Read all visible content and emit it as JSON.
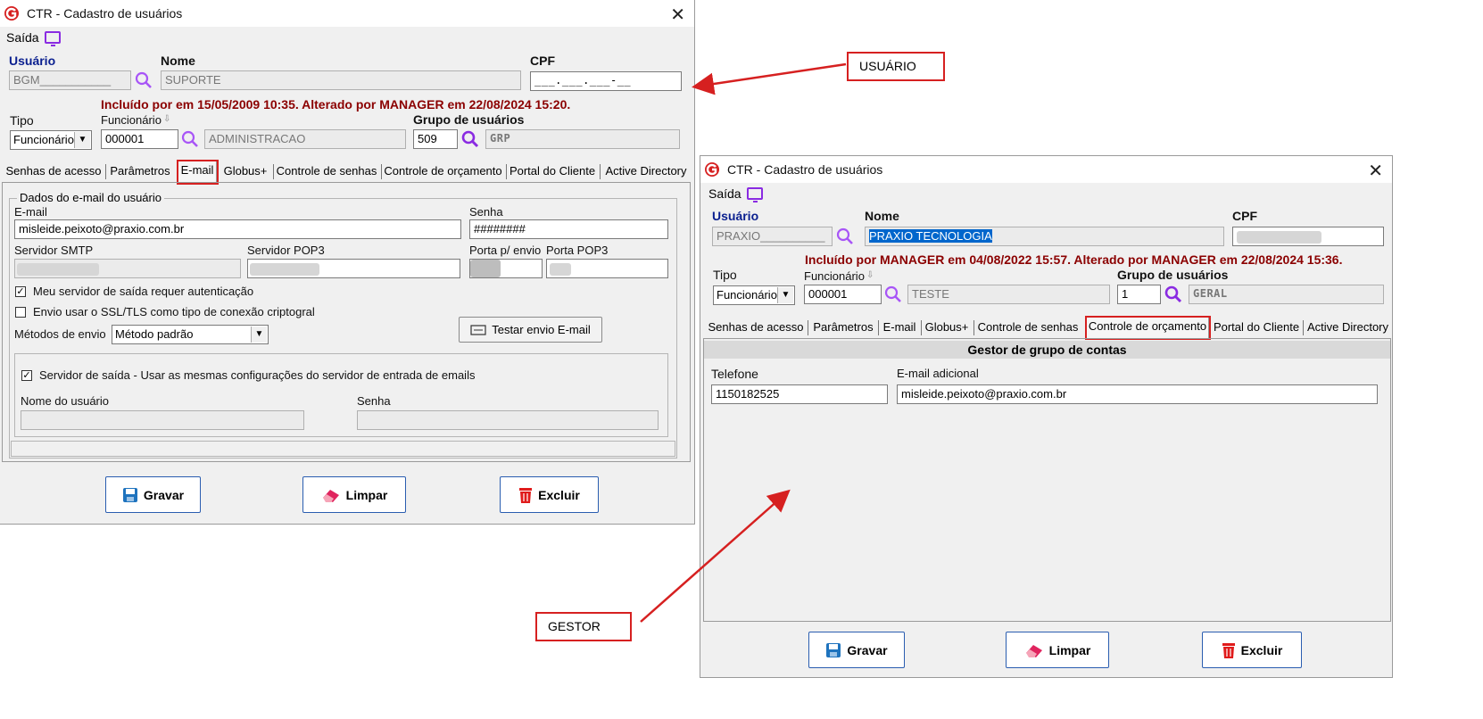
{
  "window1": {
    "title": "CTR - Cadastro de usuários",
    "menu": "Saída",
    "usuario_label": "Usuário",
    "usuario_value": "BGM___________",
    "nome_label": "Nome",
    "nome_value": "SUPORTE",
    "cpf_label": "CPF",
    "cpf_value": "___.___.___-__",
    "info": "Incluído por  em 15/05/2009 10:35. Alterado por MANAGER em 22/08/2024 15:20.",
    "tipo_label": "Tipo",
    "tipo_value": "Funcionário",
    "funcionario_label": "Funcionário",
    "funcionario_code": "000001",
    "funcionario_name": "ADMINISTRACAO",
    "grupo_label": "Grupo de usuários",
    "grupo_code": "509",
    "grupo_name": "GRP",
    "tabs": [
      "Senhas de acesso",
      "Parâmetros",
      "E-mail",
      "Globus+",
      "Controle de senhas",
      "Controle de orçamento",
      "Portal do Cliente",
      "Active Directory"
    ],
    "email_group_title": "Dados do e-mail do usuário",
    "email_label": "E-mail",
    "email_value": "misleide.peixoto@praxio.com.br",
    "senha_label": "Senha",
    "senha_value": "########",
    "smtp_label": "Servidor SMTP",
    "pop3_label": "Servidor POP3",
    "porta_envio_label": "Porta p/ envio",
    "porta_pop3_label": "Porta POP3",
    "cb_auth": "Meu servidor de saída requer autenticação",
    "cb_ssl": "Envio usar o SSL/TLS como tipo de conexão criptogral",
    "metodos_label": "Métodos de envio",
    "metodos_value": "Método padrão",
    "testar_btn": "Testar envio E-mail",
    "cb_saida": "Servidor de saída - Usar as mesmas configurações do servidor de entrada de emails",
    "nome_usuario_label": "Nome do usuário",
    "senha2_label": "Senha",
    "btn_gravar": "Gravar",
    "btn_limpar": "Limpar",
    "btn_excluir": "Excluir"
  },
  "window2": {
    "title": "CTR - Cadastro de usuários",
    "menu": "Saída",
    "usuario_label": "Usuário",
    "usuario_value": "PRAXIO__________",
    "nome_label": "Nome",
    "nome_value": "PRAXIO TECNOLOGIA",
    "cpf_label": "CPF",
    "info": "Incluído por MANAGER em 04/08/2022 15:57. Alterado por MANAGER em 22/08/2024 15:36.",
    "tipo_label": "Tipo",
    "tipo_value": "Funcionário",
    "funcionario_label": "Funcionário",
    "funcionario_code": "000001",
    "funcionario_name": "TESTE",
    "grupo_label": "Grupo de usuários",
    "grupo_code": "1",
    "grupo_name": "GERAL",
    "tabs": [
      "Senhas de acesso",
      "Parâmetros",
      "E-mail",
      "Globus+",
      "Controle de senhas",
      "Controle de orçamento",
      "Portal do Cliente",
      "Active Directory"
    ],
    "gestor_title": "Gestor de grupo de contas",
    "telefone_label": "Telefone",
    "telefone_value": "1150182525",
    "email_adicional_label": "E-mail adicional",
    "email_adicional_value": "misleide.peixoto@praxio.com.br",
    "btn_gravar": "Gravar",
    "btn_limpar": "Limpar",
    "btn_excluir": "Excluir"
  },
  "callouts": {
    "usuario": "USUÁRIO",
    "gestor": "GESTOR"
  },
  "colors": {
    "annotation_red": "#d62020",
    "info_text": "#8b0000",
    "label_blue": "#0a1f8f",
    "search_icon": "#a855f7"
  }
}
